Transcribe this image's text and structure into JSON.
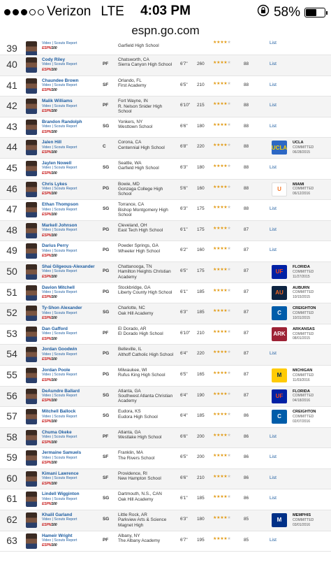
{
  "status_bar": {
    "carrier": "Verizon",
    "network": "LTE",
    "time": "4:03 PM",
    "battery": "58%",
    "battery_level": 0.58,
    "signal_bars": 3,
    "signal_total": 5,
    "icons": [
      "signal-dots-icon",
      "rotation-lock-icon",
      "battery-icon"
    ]
  },
  "url": "espn.go.com",
  "labels": {
    "video": "Video",
    "scouts_report": "Scouts Report",
    "espn": "ESPN",
    "hundred": "100",
    "list": "List"
  },
  "colors": {
    "link": "#1c5ca0",
    "stars": "#e29b16",
    "espn_red": "#c81f1f"
  },
  "players": [
    {
      "rank": "39",
      "name": "",
      "pos": "",
      "home": "",
      "school": "Garfield High School",
      "ht": "",
      "wt": "",
      "stars": 4,
      "grade": "",
      "commit": null
    },
    {
      "rank": "40",
      "name": "Cody Riley",
      "pos": "PF",
      "home": "Chatsworth, CA",
      "school": "Sierra Canyon High School",
      "ht": "6'7\"",
      "wt": "260",
      "stars": 4,
      "grade": "88",
      "commit": null
    },
    {
      "rank": "41",
      "name": "Chaundee Brown",
      "pos": "SF",
      "home": "Orlando, FL",
      "school": "First Academy",
      "ht": "6'5\"",
      "wt": "210",
      "stars": 4,
      "grade": "88",
      "commit": null
    },
    {
      "rank": "42",
      "name": "Malik Williams",
      "pos": "PF",
      "home": "Fort Wayne, IN",
      "school": "R. Nelson Snider High School",
      "ht": "6'10\"",
      "wt": "215",
      "stars": 4,
      "grade": "88",
      "commit": null
    },
    {
      "rank": "43",
      "name": "Brandon Randolph",
      "pos": "SG",
      "home": "Yonkers, NY",
      "school": "Westtown School",
      "ht": "6'6\"",
      "wt": "180",
      "stars": 4,
      "grade": "88",
      "commit": null
    },
    {
      "rank": "44",
      "name": "Jalen Hill",
      "pos": "C",
      "home": "Corona, CA",
      "school": "Centennial High School",
      "ht": "6'8\"",
      "wt": "220",
      "stars": 4,
      "grade": "88",
      "commit": {
        "school": "UCLA",
        "status": "COMMITTED",
        "date": "06/28/2015",
        "logo_text": "UCLA",
        "bg": "#2d68c4",
        "fg": "#ffd100"
      }
    },
    {
      "rank": "45",
      "name": "Jaylen Nowell",
      "pos": "SG",
      "home": "Seattle, WA",
      "school": "Garfield High School",
      "ht": "6'3\"",
      "wt": "180",
      "stars": 4,
      "grade": "88",
      "commit": null
    },
    {
      "rank": "46",
      "name": "Chris Lykes",
      "pos": "PG",
      "home": "Bowie, MD",
      "school": "Gonzaga College High School",
      "ht": "5'6\"",
      "wt": "160",
      "stars": 4,
      "grade": "88",
      "commit": {
        "school": "MIAMI",
        "status": "COMMITTED",
        "date": "06/12/2016",
        "logo_text": "U",
        "bg": "#ffffff",
        "fg": "#f47321"
      }
    },
    {
      "rank": "47",
      "name": "Ethan Thompson",
      "pos": "SG",
      "home": "Torrance, CA",
      "school": "Bishop Montgomery High School",
      "ht": "6'3\"",
      "wt": "175",
      "stars": 4,
      "grade": "88",
      "commit": null
    },
    {
      "rank": "48",
      "name": "Markell Johnson",
      "pos": "PG",
      "home": "Cleveland, OH",
      "school": "East Tech High School",
      "ht": "6'1\"",
      "wt": "175",
      "stars": 4,
      "grade": "87",
      "commit": null
    },
    {
      "rank": "49",
      "name": "Darius Perry",
      "pos": "PG",
      "home": "Powder Springs, GA",
      "school": "Wheeler High School",
      "ht": "6'2\"",
      "wt": "160",
      "stars": 4,
      "grade": "87",
      "commit": null
    },
    {
      "rank": "50",
      "name": "Shai Gilgeous-Alexander",
      "pos": "PG",
      "home": "Chattanooga, TN",
      "school": "Hamilton Heights Christian Academy",
      "ht": "6'5\"",
      "wt": "175",
      "stars": 4,
      "grade": "87",
      "commit": {
        "school": "FLORIDA",
        "status": "COMMITTED",
        "date": "11/27/2015",
        "logo_text": "UF",
        "bg": "#0021a5",
        "fg": "#fa4616"
      }
    },
    {
      "rank": "51",
      "name": "Davion Mitchell",
      "pos": "PG",
      "home": "Stockbridge, GA",
      "school": "Liberty County High School",
      "ht": "6'1\"",
      "wt": "185",
      "stars": 4,
      "grade": "87",
      "commit": {
        "school": "AUBURN",
        "status": "COMMITTED",
        "date": "10/15/2015",
        "logo_text": "AU",
        "bg": "#0c2340",
        "fg": "#f26522"
      }
    },
    {
      "rank": "52",
      "name": "Ty-Shon Alexander",
      "pos": "SG",
      "home": "Charlotte, NC",
      "school": "Oak Hill Academy",
      "ht": "6'3\"",
      "wt": "185",
      "stars": 4,
      "grade": "87",
      "commit": {
        "school": "CREIGHTON",
        "status": "COMMITTED",
        "date": "10/31/2015",
        "logo_text": "C",
        "bg": "#005ca9",
        "fg": "#ffffff"
      }
    },
    {
      "rank": "53",
      "name": "Dan Gafford",
      "pos": "PF",
      "home": "El Dorado, AR",
      "school": "El Dorado High School",
      "ht": "6'10\"",
      "wt": "210",
      "stars": 4,
      "grade": "87",
      "commit": {
        "school": "ARKANSAS",
        "status": "COMMITTED",
        "date": "08/01/2015",
        "logo_text": "ARK",
        "bg": "#9d2235",
        "fg": "#ffffff"
      }
    },
    {
      "rank": "54",
      "name": "Jordan Goodwin",
      "pos": "PG",
      "home": "Belleville, IL",
      "school": "Althoff Catholic High School",
      "ht": "6'4\"",
      "wt": "220",
      "stars": 4,
      "grade": "87",
      "commit": null
    },
    {
      "rank": "55",
      "name": "Jordan Poole",
      "pos": "PG",
      "home": "Milwaukee, WI",
      "school": "Rufus King High School",
      "ht": "6'5\"",
      "wt": "165",
      "stars": 4,
      "grade": "87",
      "commit": {
        "school": "MICHIGAN",
        "status": "COMMITTED",
        "date": "11/03/2016",
        "logo_text": "M",
        "bg": "#ffcb05",
        "fg": "#00274c"
      }
    },
    {
      "rank": "56",
      "name": "DeAundre Ballard",
      "pos": "SG",
      "home": "Atlanta, GA",
      "school": "Southwest Atlanta Christian Academy",
      "ht": "6'4\"",
      "wt": "190",
      "stars": 4,
      "grade": "87",
      "commit": {
        "school": "FLORIDA",
        "status": "COMMITTED",
        "date": "04/18/2016",
        "logo_text": "UF",
        "bg": "#0021a5",
        "fg": "#fa4616"
      }
    },
    {
      "rank": "57",
      "name": "Mitchell Ballock",
      "pos": "SG",
      "home": "Eudora, KS",
      "school": "Eudora High School",
      "ht": "6'4\"",
      "wt": "185",
      "stars": 4,
      "grade": "86",
      "commit": {
        "school": "CREIGHTON",
        "status": "COMMITTED",
        "date": "02/07/2016",
        "logo_text": "C",
        "bg": "#005ca9",
        "fg": "#ffffff"
      }
    },
    {
      "rank": "58",
      "name": "Chuma Okeke",
      "pos": "PF",
      "home": "Atlanta, GA",
      "school": "Westlake High School",
      "ht": "6'6\"",
      "wt": "200",
      "stars": 4,
      "grade": "86",
      "commit": null
    },
    {
      "rank": "59",
      "name": "Jermaine Samuels",
      "pos": "SF",
      "home": "Franklin, MA",
      "school": "The Rivers School",
      "ht": "6'5\"",
      "wt": "200",
      "stars": 4,
      "grade": "86",
      "commit": null
    },
    {
      "rank": "60",
      "name": "Kimani Lawrence",
      "pos": "SF",
      "home": "Providence, RI",
      "school": "New Hampton School",
      "ht": "6'6\"",
      "wt": "210",
      "stars": 4,
      "grade": "86",
      "commit": null
    },
    {
      "rank": "61",
      "name": "Lindell Wigginton",
      "pos": "SG",
      "home": "Dartmouth, N.S., CAN",
      "school": "Oak Hill Academy",
      "ht": "6'1\"",
      "wt": "185",
      "stars": 4,
      "grade": "86",
      "commit": null
    },
    {
      "rank": "62",
      "name": "Khalil Garland",
      "pos": "SG",
      "home": "Little Rock, AR",
      "school": "Parkview Arts & Science Magnet High",
      "ht": "6'3\"",
      "wt": "180",
      "stars": 4,
      "grade": "85",
      "commit": {
        "school": "MEMPHIS",
        "status": "COMMITTED",
        "date": "03/01/2016",
        "logo_text": "M",
        "bg": "#003087",
        "fg": "#ffffff"
      }
    },
    {
      "rank": "63",
      "name": "Hameir Wright",
      "pos": "PF",
      "home": "Albany, NY",
      "school": "The Albany Academy",
      "ht": "6'7\"",
      "wt": "195",
      "stars": 4,
      "grade": "85",
      "commit": null
    }
  ]
}
